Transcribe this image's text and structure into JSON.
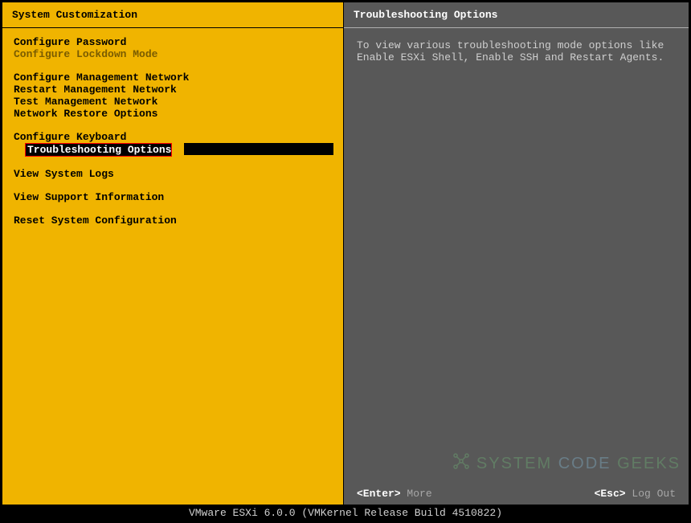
{
  "left": {
    "title": "System Customization",
    "groups": [
      [
        {
          "label": "Configure Password",
          "dim": false,
          "selected": false
        },
        {
          "label": "Configure Lockdown Mode",
          "dim": true,
          "selected": false
        }
      ],
      [
        {
          "label": "Configure Management Network",
          "dim": false,
          "selected": false
        },
        {
          "label": "Restart Management Network",
          "dim": false,
          "selected": false
        },
        {
          "label": "Test Management Network",
          "dim": false,
          "selected": false
        },
        {
          "label": "Network Restore Options",
          "dim": false,
          "selected": false
        }
      ],
      [
        {
          "label": "Configure Keyboard",
          "dim": false,
          "selected": false
        },
        {
          "label": "Troubleshooting Options",
          "dim": false,
          "selected": true
        }
      ],
      [
        {
          "label": "View System Logs",
          "dim": false,
          "selected": false
        }
      ],
      [
        {
          "label": "View Support Information",
          "dim": false,
          "selected": false
        }
      ],
      [
        {
          "label": "Reset System Configuration",
          "dim": false,
          "selected": false
        }
      ]
    ]
  },
  "right": {
    "title": "Troubleshooting Options",
    "desc": "To view various troubleshooting mode options like Enable ESXi Shell, Enable SSH and Restart Agents.",
    "footer": {
      "enter_key": "<Enter>",
      "enter_label": "More",
      "esc_key": "<Esc>",
      "esc_label": "Log Out"
    }
  },
  "watermark": {
    "w1": "SYSTEM",
    "w2": "CODE",
    "w3": "GEEKS"
  },
  "bottom": "VMware ESXi 6.0.0 (VMKernel Release Build 4510822)"
}
